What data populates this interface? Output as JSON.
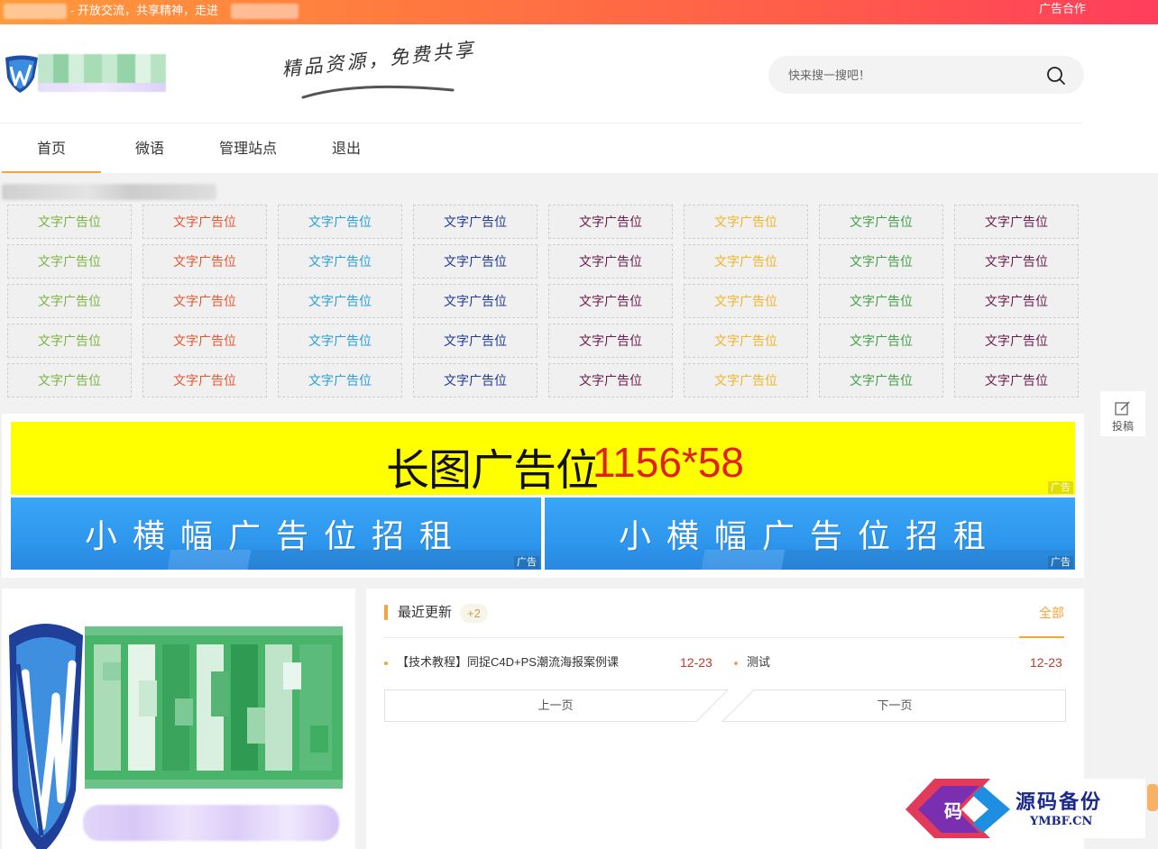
{
  "topbar": {
    "slogan": "- 开放交流，共享精神，走进",
    "ad_cooperation": "广告合作"
  },
  "header": {
    "tagline": "精品资源，免费共享",
    "search_placeholder": "快来搜一搜吧！",
    "search_icon": "search-icon"
  },
  "nav": {
    "items": [
      {
        "label": "首页",
        "active": true
      },
      {
        "label": "微语",
        "active": false
      },
      {
        "label": "管理站点",
        "active": false
      },
      {
        "label": "退出",
        "active": false
      }
    ],
    "active_color": "#f5a33d"
  },
  "text_ads": {
    "label": "文字广告位",
    "column_colors": [
      "#7cb342",
      "#e4572e",
      "#2a9fd6",
      "#1f3a93",
      "#6a1b4d",
      "#f0b429",
      "#43a047",
      "#6a1b4d"
    ],
    "rows": 5
  },
  "banners": {
    "long_ad_text": "长图广告位",
    "long_ad_size": "1156*58",
    "ad_tag": "广告",
    "small_ads": [
      "小横幅广告位招租",
      "小横幅广告位招租"
    ]
  },
  "recent": {
    "title": "最近更新",
    "badge": "+2",
    "all_label": "全部",
    "posts": [
      {
        "title": "【技术教程】同捉C4D+PS潮流海报案例课",
        "date": "12-23"
      },
      {
        "title": "测试",
        "date": "12-23"
      }
    ],
    "prev": "上一页",
    "next": "下一页"
  },
  "float": {
    "submit_label": "投稿",
    "icon": "edit-icon"
  },
  "watermark": {
    "cn": "源码备份",
    "en": "YMBF.CN",
    "code_char": "码"
  }
}
